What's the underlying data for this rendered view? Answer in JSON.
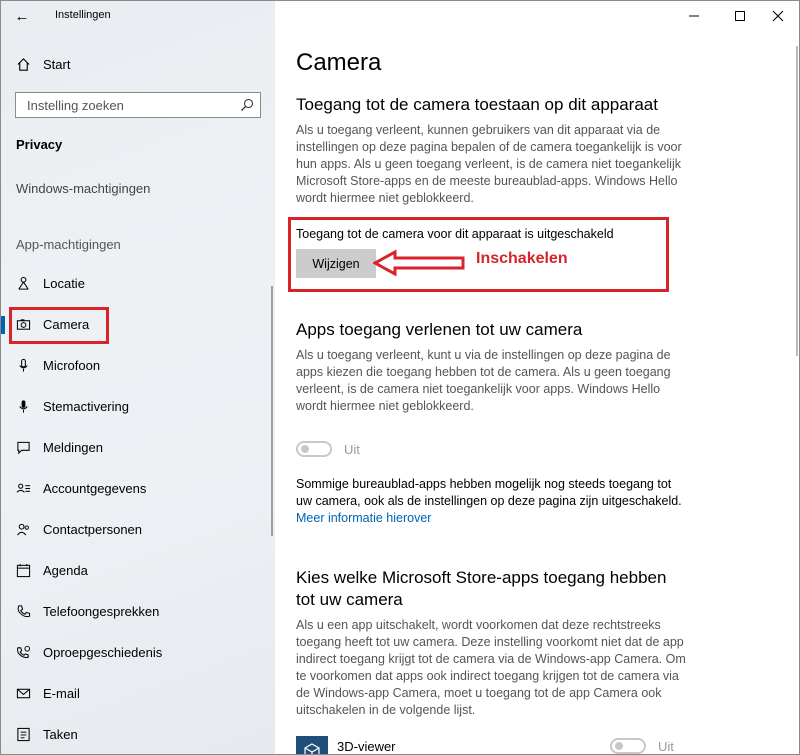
{
  "window": {
    "title": "Instellingen"
  },
  "sidebar": {
    "home_label": "Start",
    "search_placeholder": "Instelling zoeken",
    "section_title": "Privacy",
    "windows_permissions_label": "Windows-machtigingen",
    "app_permissions_label": "App-machtigingen",
    "items": [
      {
        "label": "Locatie",
        "icon": "location-icon"
      },
      {
        "label": "Camera",
        "icon": "camera-icon",
        "selected": true
      },
      {
        "label": "Microfoon",
        "icon": "microphone-icon"
      },
      {
        "label": "Stemactivering",
        "icon": "voice-activation-icon"
      },
      {
        "label": "Meldingen",
        "icon": "notifications-icon"
      },
      {
        "label": "Accountgegevens",
        "icon": "account-info-icon"
      },
      {
        "label": "Contactpersonen",
        "icon": "contacts-icon"
      },
      {
        "label": "Agenda",
        "icon": "calendar-icon"
      },
      {
        "label": "Telefoongesprekken",
        "icon": "phone-icon"
      },
      {
        "label": "Oproepgeschiedenis",
        "icon": "call-history-icon"
      },
      {
        "label": "E-mail",
        "icon": "mail-icon"
      },
      {
        "label": "Taken",
        "icon": "tasks-icon"
      }
    ]
  },
  "main": {
    "page_title": "Camera",
    "device_access": {
      "heading": "Toegang tot de camera toestaan op dit apparaat",
      "description": "Als u toegang verleent, kunnen gebruikers van dit apparaat via de instellingen op deze pagina bepalen of de camera toegankelijk is voor hun apps. Als u geen toegang verleent, is de camera niet toegankelijk Microsoft Store-apps en de meeste bureaublad-apps. Windows Hello wordt hiermee niet geblokkeerd.",
      "status": "Toegang tot de camera voor dit apparaat is uitgeschakeld",
      "change_button": "Wijzigen"
    },
    "app_access": {
      "heading": "Apps toegang verlenen tot uw camera",
      "description": "Als u toegang verleent, kunt u via de instellingen op deze pagina de apps kiezen die toegang hebben tot de camera. Als u geen toegang verleent, is de camera niet toegankelijk voor apps. Windows Hello wordt hiermee niet geblokkeerd.",
      "toggle_label": "Uit",
      "toggle_on": false,
      "note": "Sommige bureaublad-apps hebben mogelijk nog steeds toegang tot uw camera, ook als de instellingen op deze pagina zijn uitgeschakeld.",
      "more_info_link": "Meer informatie hierover"
    },
    "store_apps": {
      "heading_line1": "Kies welke Microsoft Store-apps toegang hebben",
      "heading_line2": "tot uw camera",
      "description": "Als u een app uitschakelt, wordt voorkomen dat deze rechtstreeks toegang heeft tot uw camera. Deze instelling voorkomt niet dat de app indirect toegang krijgt tot de camera via de Windows-app Camera. Om te voorkomen dat apps ook indirect toegang krijgen tot de camera via de Windows-app Camera, moet u toegang tot de app Camera ook uitschakelen in de volgende lijst.",
      "apps": [
        {
          "name": "3D-viewer",
          "toggle_label": "Uit",
          "toggle_on": false
        }
      ]
    }
  },
  "annotation": {
    "label": "Inschakelen",
    "color": "#d6242a"
  },
  "colors": {
    "accent": "#0063b1",
    "annotation": "#d6242a"
  }
}
